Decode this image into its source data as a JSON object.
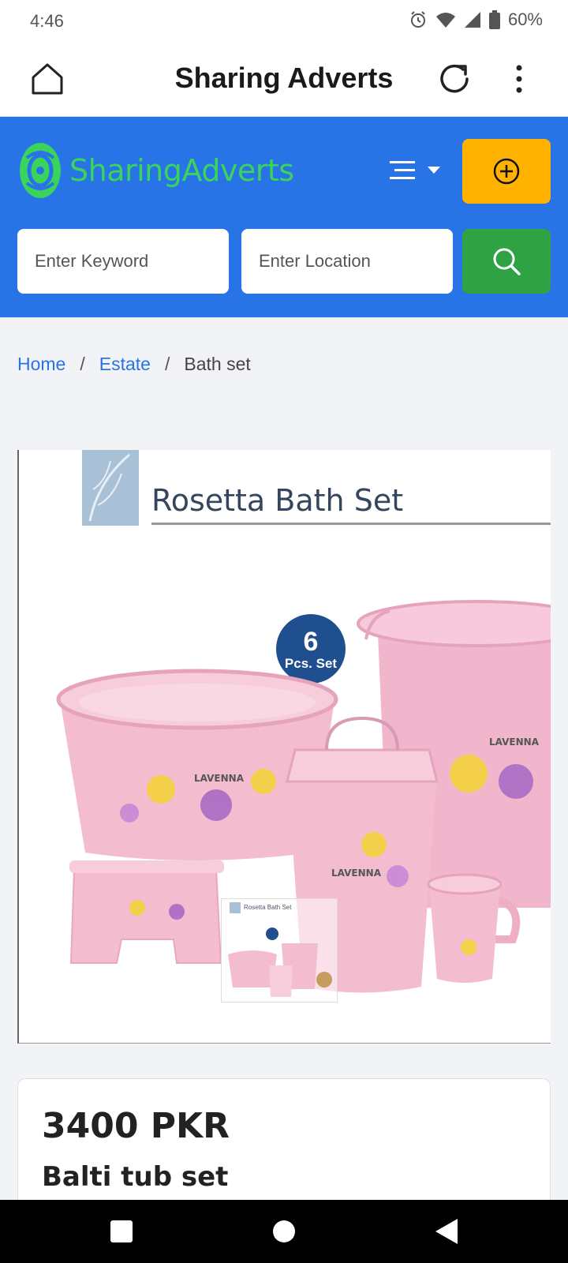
{
  "status_bar": {
    "time": "4:46",
    "battery": "60%"
  },
  "app_bar": {
    "title": "Sharing Adverts"
  },
  "header": {
    "logo_text_part1": "Sharing",
    "logo_text_part2": "Adverts",
    "keyword_placeholder": "Enter Keyword",
    "location_placeholder": "Enter Location"
  },
  "breadcrumb": {
    "home": "Home",
    "category": "Estate",
    "current": "Bath set",
    "separator": "/"
  },
  "product_image": {
    "title": "Rosetta Bath Set",
    "badge_number": "6",
    "badge_label": "Pcs. Set",
    "brand": "LAVENNA",
    "thumb_title": "Rosetta Bath Set"
  },
  "product": {
    "price": "3400 PKR",
    "name": "Balti tub set"
  },
  "colors": {
    "primary": "#2873e6",
    "accent": "#ffb300",
    "search": "#2fa244",
    "logo": "#3ad35b"
  },
  "icons": [
    "home-icon",
    "refresh-icon",
    "more-vert-icon",
    "menu-icon",
    "plus-circle-icon",
    "search-icon",
    "alarm-icon",
    "wifi-icon",
    "signal-icon",
    "battery-icon"
  ]
}
